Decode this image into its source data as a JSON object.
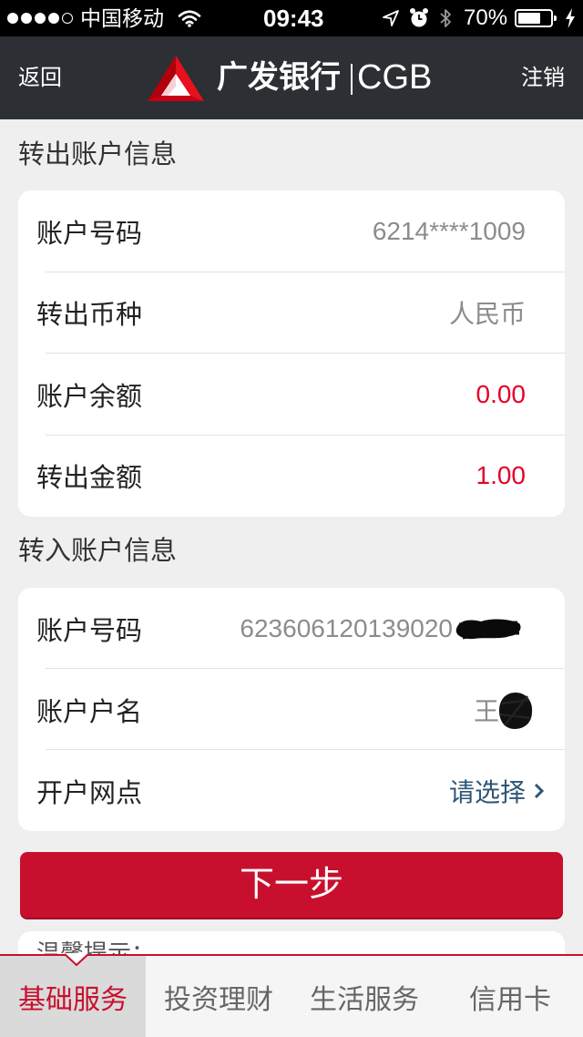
{
  "status_bar": {
    "signal_strength": 4,
    "signal_max": 5,
    "carrier": "中国移动",
    "time": "09:43",
    "battery_text": "70%",
    "battery_level": 0.7,
    "icons": [
      "wifi-icon",
      "location-icon",
      "alarm-icon",
      "bluetooth-icon",
      "battery-icon",
      "charging-icon"
    ]
  },
  "nav": {
    "back_label": "返回",
    "logo_icon": "cgb-logo-icon",
    "bank_name": "广发银行",
    "bank_code": "CGB",
    "logout_label": "注销"
  },
  "transfer_out": {
    "title": "转出账户信息",
    "rows": [
      {
        "label": "账户号码",
        "value": "6214****1009"
      },
      {
        "label": "转出币种",
        "value": "人民币"
      },
      {
        "label": "账户余额",
        "value": "0.00"
      },
      {
        "label": "转出金额",
        "value": "1.00"
      }
    ]
  },
  "transfer_in": {
    "title": "转入账户信息",
    "rows": [
      {
        "label": "账户号码",
        "value": "623606120139020"
      },
      {
        "label": "账户户名",
        "value": "王"
      },
      {
        "label": "开户网点",
        "value": "请选择",
        "icon": "chevron-right-icon"
      }
    ]
  },
  "next_button_label": "下一步",
  "tips": {
    "title": "温馨提示："
  },
  "tab_bar": {
    "tabs": [
      {
        "label": "基础服务",
        "active": true
      },
      {
        "label": "投资理财",
        "active": false
      },
      {
        "label": "生活服务",
        "active": false
      },
      {
        "label": "信用卡",
        "active": false
      }
    ]
  },
  "colors": {
    "brand_red": "#c8102e",
    "amount_red": "#e60027",
    "link_blue": "#2f5676",
    "nav_bg": "#2c2f34",
    "muted_text": "#8c8c8c"
  }
}
